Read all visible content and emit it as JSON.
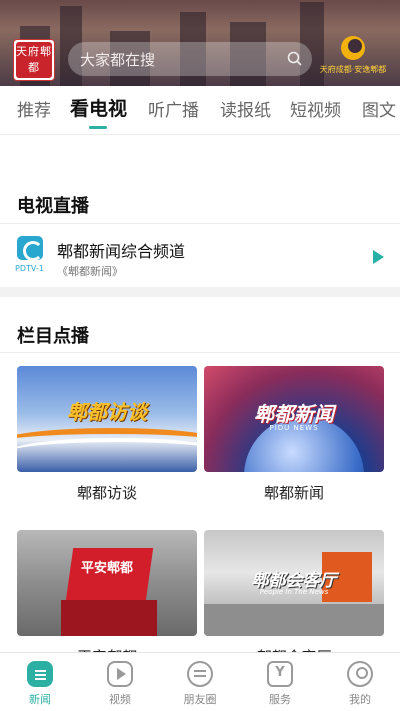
{
  "header": {
    "logo_text": "天府郫都",
    "search_placeholder": "大家都在搜",
    "brand_text": "天府成都·安逸郫都"
  },
  "tabs": [
    {
      "label": "推荐",
      "active": false
    },
    {
      "label": "看电视",
      "active": true
    },
    {
      "label": "听广播",
      "active": false
    },
    {
      "label": "读报纸",
      "active": false
    },
    {
      "label": "短视频",
      "active": false
    },
    {
      "label": "图文",
      "active": false
    }
  ],
  "live": {
    "title": "电视直播",
    "channel_name": "郫都新闻综合频道",
    "channel_code": "PDTV-1",
    "channel_program": "《郫都新闻》"
  },
  "vod": {
    "title": "栏目点播",
    "programs": [
      {
        "label": "郫都访谈",
        "thumb_title": "郫都访谈"
      },
      {
        "label": "郫都新闻",
        "thumb_title": "郫都新闻",
        "thumb_sub": "PIDU NEWS"
      },
      {
        "label": "平安郫都",
        "thumb_title": "平安郫都"
      },
      {
        "label": "郫都会客厅",
        "thumb_title": "郫都会客厅",
        "thumb_sub": "People In The News"
      }
    ]
  },
  "bottom_nav": [
    {
      "label": "新闻",
      "icon": "news-icon",
      "active": true
    },
    {
      "label": "视频",
      "icon": "video-icon",
      "active": false
    },
    {
      "label": "朋友圈",
      "icon": "friends-icon",
      "active": false
    },
    {
      "label": "服务",
      "icon": "service-icon",
      "active": false
    },
    {
      "label": "我的",
      "icon": "profile-icon",
      "active": false
    }
  ],
  "colors": {
    "accent": "#2bb0a3",
    "logo_red": "#c9242b"
  }
}
